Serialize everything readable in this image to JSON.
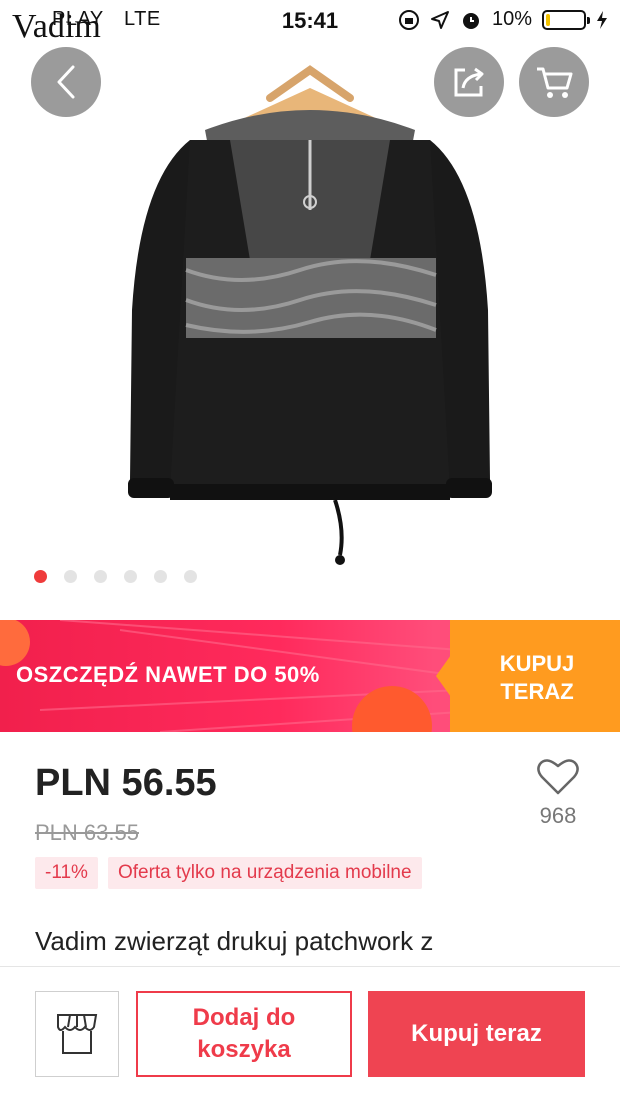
{
  "status_bar": {
    "carrier": "PLAY",
    "network": "LTE",
    "brand_overlay": "Vadim",
    "time": "15:41",
    "battery": "10%",
    "battery_level": 0.1,
    "icons": [
      "signal-icon",
      "orientation-lock-icon",
      "location-icon",
      "alarm-icon",
      "battery-icon",
      "charging-icon"
    ]
  },
  "gallery": {
    "image_count": 6,
    "active_index": 0,
    "buttons": [
      "back-icon",
      "share-icon",
      "cart-icon"
    ]
  },
  "promo": {
    "text": "OSZCZĘDŹ NAWET DO 50%",
    "cta_line1": "KUPUJ",
    "cta_line2": "TERAZ",
    "colors": {
      "banner": "#f1204c",
      "cta": "#ff9b1f"
    }
  },
  "product": {
    "price": "PLN 56.55",
    "old_price": "PLN 63.55",
    "discount_badge": "-11%",
    "mobile_offer_badge": "Oferta tylko na urządzenia mobilne",
    "wishlist_count": "968",
    "title": "Vadim zwierząt drukuj patchwork z"
  },
  "bottom_bar": {
    "store_icon": "store-icon",
    "add_to_cart_line1": "Dodaj do",
    "add_to_cart_line2": "koszyka",
    "buy_now": "Kupuj teraz",
    "accent": "#ef4452"
  }
}
